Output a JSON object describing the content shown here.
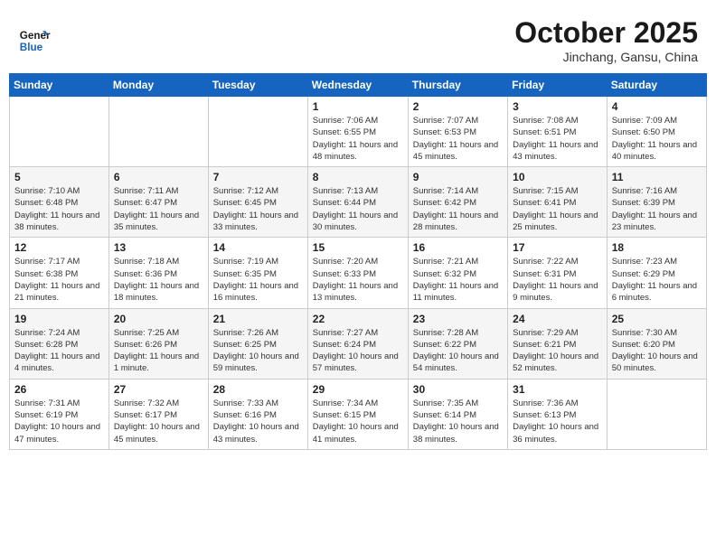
{
  "header": {
    "logo_line1": "General",
    "logo_line2": "Blue",
    "month": "October 2025",
    "location": "Jinchang, Gansu, China"
  },
  "days_of_week": [
    "Sunday",
    "Monday",
    "Tuesday",
    "Wednesday",
    "Thursday",
    "Friday",
    "Saturday"
  ],
  "weeks": [
    [
      {
        "day": "",
        "info": ""
      },
      {
        "day": "",
        "info": ""
      },
      {
        "day": "",
        "info": ""
      },
      {
        "day": "1",
        "info": "Sunrise: 7:06 AM\nSunset: 6:55 PM\nDaylight: 11 hours\nand 48 minutes."
      },
      {
        "day": "2",
        "info": "Sunrise: 7:07 AM\nSunset: 6:53 PM\nDaylight: 11 hours\nand 45 minutes."
      },
      {
        "day": "3",
        "info": "Sunrise: 7:08 AM\nSunset: 6:51 PM\nDaylight: 11 hours\nand 43 minutes."
      },
      {
        "day": "4",
        "info": "Sunrise: 7:09 AM\nSunset: 6:50 PM\nDaylight: 11 hours\nand 40 minutes."
      }
    ],
    [
      {
        "day": "5",
        "info": "Sunrise: 7:10 AM\nSunset: 6:48 PM\nDaylight: 11 hours\nand 38 minutes."
      },
      {
        "day": "6",
        "info": "Sunrise: 7:11 AM\nSunset: 6:47 PM\nDaylight: 11 hours\nand 35 minutes."
      },
      {
        "day": "7",
        "info": "Sunrise: 7:12 AM\nSunset: 6:45 PM\nDaylight: 11 hours\nand 33 minutes."
      },
      {
        "day": "8",
        "info": "Sunrise: 7:13 AM\nSunset: 6:44 PM\nDaylight: 11 hours\nand 30 minutes."
      },
      {
        "day": "9",
        "info": "Sunrise: 7:14 AM\nSunset: 6:42 PM\nDaylight: 11 hours\nand 28 minutes."
      },
      {
        "day": "10",
        "info": "Sunrise: 7:15 AM\nSunset: 6:41 PM\nDaylight: 11 hours\nand 25 minutes."
      },
      {
        "day": "11",
        "info": "Sunrise: 7:16 AM\nSunset: 6:39 PM\nDaylight: 11 hours\nand 23 minutes."
      }
    ],
    [
      {
        "day": "12",
        "info": "Sunrise: 7:17 AM\nSunset: 6:38 PM\nDaylight: 11 hours\nand 21 minutes."
      },
      {
        "day": "13",
        "info": "Sunrise: 7:18 AM\nSunset: 6:36 PM\nDaylight: 11 hours\nand 18 minutes."
      },
      {
        "day": "14",
        "info": "Sunrise: 7:19 AM\nSunset: 6:35 PM\nDaylight: 11 hours\nand 16 minutes."
      },
      {
        "day": "15",
        "info": "Sunrise: 7:20 AM\nSunset: 6:33 PM\nDaylight: 11 hours\nand 13 minutes."
      },
      {
        "day": "16",
        "info": "Sunrise: 7:21 AM\nSunset: 6:32 PM\nDaylight: 11 hours\nand 11 minutes."
      },
      {
        "day": "17",
        "info": "Sunrise: 7:22 AM\nSunset: 6:31 PM\nDaylight: 11 hours\nand 9 minutes."
      },
      {
        "day": "18",
        "info": "Sunrise: 7:23 AM\nSunset: 6:29 PM\nDaylight: 11 hours\nand 6 minutes."
      }
    ],
    [
      {
        "day": "19",
        "info": "Sunrise: 7:24 AM\nSunset: 6:28 PM\nDaylight: 11 hours\nand 4 minutes."
      },
      {
        "day": "20",
        "info": "Sunrise: 7:25 AM\nSunset: 6:26 PM\nDaylight: 11 hours\nand 1 minute."
      },
      {
        "day": "21",
        "info": "Sunrise: 7:26 AM\nSunset: 6:25 PM\nDaylight: 10 hours\nand 59 minutes."
      },
      {
        "day": "22",
        "info": "Sunrise: 7:27 AM\nSunset: 6:24 PM\nDaylight: 10 hours\nand 57 minutes."
      },
      {
        "day": "23",
        "info": "Sunrise: 7:28 AM\nSunset: 6:22 PM\nDaylight: 10 hours\nand 54 minutes."
      },
      {
        "day": "24",
        "info": "Sunrise: 7:29 AM\nSunset: 6:21 PM\nDaylight: 10 hours\nand 52 minutes."
      },
      {
        "day": "25",
        "info": "Sunrise: 7:30 AM\nSunset: 6:20 PM\nDaylight: 10 hours\nand 50 minutes."
      }
    ],
    [
      {
        "day": "26",
        "info": "Sunrise: 7:31 AM\nSunset: 6:19 PM\nDaylight: 10 hours\nand 47 minutes."
      },
      {
        "day": "27",
        "info": "Sunrise: 7:32 AM\nSunset: 6:17 PM\nDaylight: 10 hours\nand 45 minutes."
      },
      {
        "day": "28",
        "info": "Sunrise: 7:33 AM\nSunset: 6:16 PM\nDaylight: 10 hours\nand 43 minutes."
      },
      {
        "day": "29",
        "info": "Sunrise: 7:34 AM\nSunset: 6:15 PM\nDaylight: 10 hours\nand 41 minutes."
      },
      {
        "day": "30",
        "info": "Sunrise: 7:35 AM\nSunset: 6:14 PM\nDaylight: 10 hours\nand 38 minutes."
      },
      {
        "day": "31",
        "info": "Sunrise: 7:36 AM\nSunset: 6:13 PM\nDaylight: 10 hours\nand 36 minutes."
      },
      {
        "day": "",
        "info": ""
      }
    ]
  ]
}
